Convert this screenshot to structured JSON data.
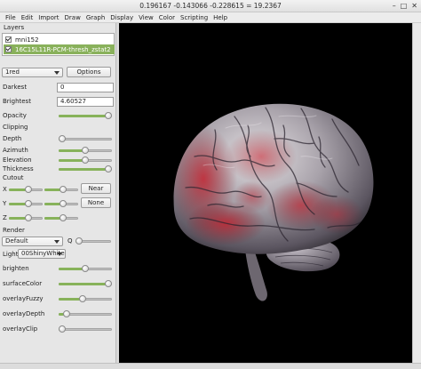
{
  "window": {
    "title": "0.196167 -0.143066 -0.228615 = 19.2367"
  },
  "menu": [
    "File",
    "Edit",
    "Import",
    "Draw",
    "Graph",
    "Display",
    "View",
    "Color",
    "Scripting",
    "Help"
  ],
  "layers": {
    "section_label": "Layers",
    "items": [
      {
        "name": "mni152",
        "checked": true,
        "selected": false
      },
      {
        "name": "16C15L11R-PCM-thresh_zstat2",
        "checked": true,
        "selected": true
      }
    ]
  },
  "colormap": {
    "value": "1red"
  },
  "options_button": "Options",
  "darkest": {
    "label": "Darkest",
    "value": "0"
  },
  "brightest": {
    "label": "Brightest",
    "value": "4.60527"
  },
  "opacity": {
    "label": "Opacity",
    "level": 1.0
  },
  "clipping": {
    "label": "Clipping",
    "depth": {
      "label": "Depth",
      "level": 0.0
    },
    "azimuth": {
      "label": "Azimuth",
      "level": 0.5
    },
    "elevation": {
      "label": "Elevation",
      "level": 0.5
    },
    "thickness": {
      "label": "Thickness",
      "level": 1.0
    }
  },
  "cutout": {
    "label": "Cutout",
    "x": {
      "label": "X",
      "level_a": 0.6,
      "level_b": 0.55
    },
    "y": {
      "label": "Y",
      "level_a": 0.6,
      "level_b": 0.55
    },
    "z": {
      "label": "Z",
      "level_a": 0.6,
      "level_b": 0.55
    },
    "near_button": "Near",
    "none_button": "None"
  },
  "render": {
    "label": "Render",
    "mode": "Default",
    "q_label": "Q",
    "q_level": 0.0,
    "light_label": "Light",
    "light": "00ShinyWhite"
  },
  "shader": [
    {
      "label": "brighten",
      "level": 0.5
    },
    {
      "label": "surfaceColor",
      "level": 1.0
    },
    {
      "label": "overlayFuzzy",
      "level": 0.45
    },
    {
      "label": "overlayDepth",
      "level": 0.1
    },
    {
      "label": "overlayClip",
      "level": 0.0
    }
  ],
  "colors": {
    "accent": "#87b25a",
    "viewport_bg": "#000000",
    "overlay": "#b0232e"
  }
}
